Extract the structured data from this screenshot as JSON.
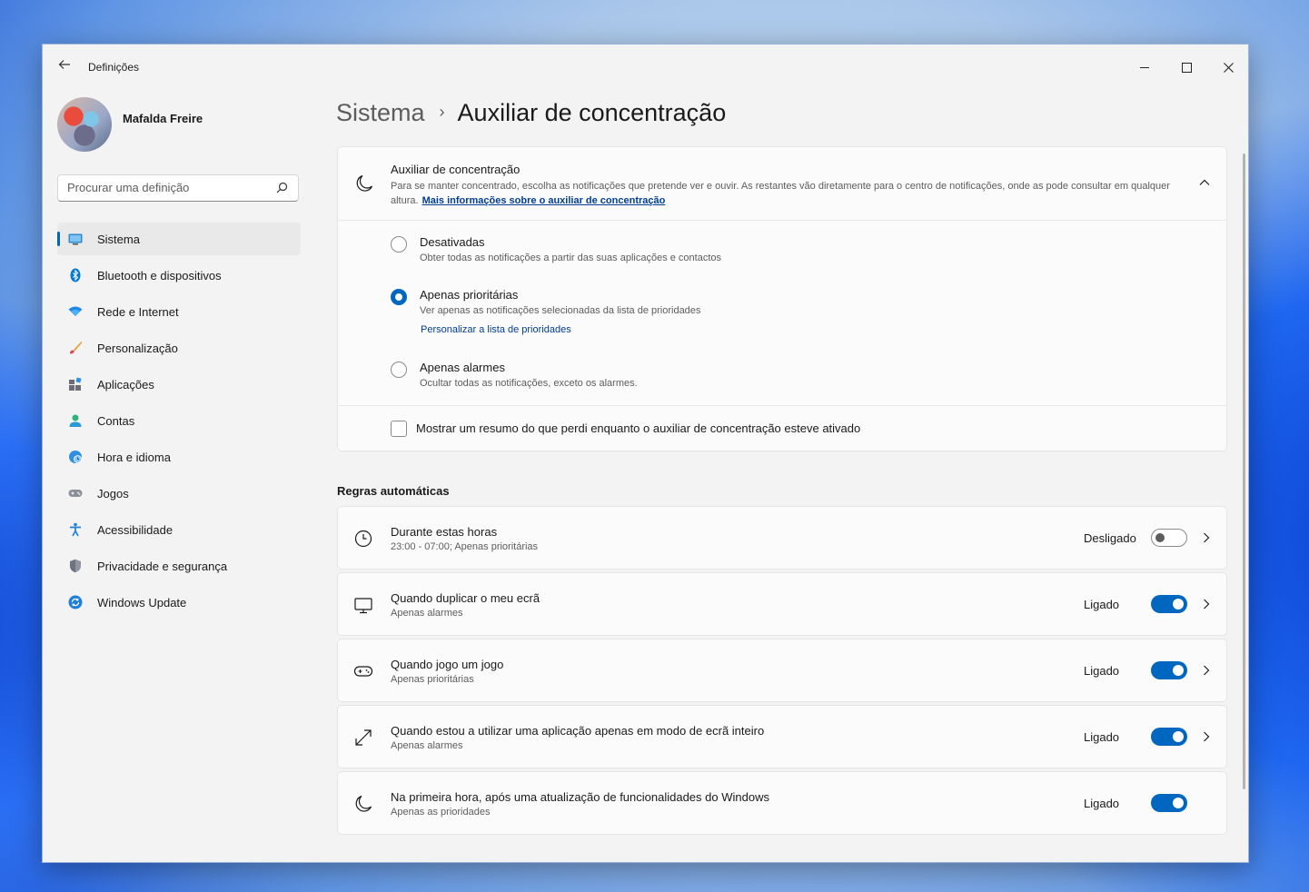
{
  "app": {
    "title": "Definições"
  },
  "user": {
    "name": "Mafalda Freire"
  },
  "search": {
    "placeholder": "Procurar uma definição"
  },
  "sidebar": {
    "items": [
      {
        "label": "Sistema",
        "icon": "system-icon",
        "active": true
      },
      {
        "label": "Bluetooth e dispositivos",
        "icon": "bluetooth-icon"
      },
      {
        "label": "Rede e Internet",
        "icon": "wifi-icon"
      },
      {
        "label": "Personalização",
        "icon": "brush-icon"
      },
      {
        "label": "Aplicações",
        "icon": "apps-icon"
      },
      {
        "label": "Contas",
        "icon": "account-icon"
      },
      {
        "label": "Hora e idioma",
        "icon": "globe-clock-icon"
      },
      {
        "label": "Jogos",
        "icon": "gamepad-icon"
      },
      {
        "label": "Acessibilidade",
        "icon": "accessibility-icon"
      },
      {
        "label": "Privacidade e segurança",
        "icon": "shield-icon"
      },
      {
        "label": "Windows Update",
        "icon": "update-icon"
      }
    ]
  },
  "breadcrumb": {
    "parent": "Sistema",
    "current": "Auxiliar de concentração"
  },
  "focus": {
    "title": "Auxiliar de concentração",
    "description": "Para se manter concentrado, escolha as notificações que pretende ver e ouvir. As restantes vão diretamente para o centro de notificações, onde as pode consultar em qualquer altura.",
    "link": "Mais informações sobre o auxiliar de concentração",
    "options": [
      {
        "title": "Desativadas",
        "subtitle": "Obter todas as notificações a partir das suas aplicações e contactos",
        "selected": false
      },
      {
        "title": "Apenas prioritárias",
        "subtitle": "Ver apenas as notificações selecionadas da lista de prioridades",
        "link": "Personalizar a lista de prioridades",
        "selected": true
      },
      {
        "title": "Apenas alarmes",
        "subtitle": "Ocultar todas as notificações, exceto os alarmes.",
        "selected": false
      }
    ],
    "summary_checkbox": {
      "label": "Mostrar um resumo do que perdi enquanto o auxiliar de concentração esteve ativado",
      "checked": false
    }
  },
  "rules": {
    "heading": "Regras automáticas",
    "items": [
      {
        "title": "Durante estas horas",
        "subtitle": "23:00 - 07:00; Apenas prioritárias",
        "state": "Desligado",
        "on": false,
        "icon": "clock-icon"
      },
      {
        "title": "Quando duplicar o meu ecrã",
        "subtitle": "Apenas alarmes",
        "state": "Ligado",
        "on": true,
        "icon": "monitor-icon"
      },
      {
        "title": "Quando jogo um jogo",
        "subtitle": "Apenas prioritárias",
        "state": "Ligado",
        "on": true,
        "icon": "gamepad-icon"
      },
      {
        "title": "Quando estou a utilizar uma aplicação apenas em modo de ecrã inteiro",
        "subtitle": "Apenas alarmes",
        "state": "Ligado",
        "on": true,
        "icon": "fullscreen-icon"
      },
      {
        "title": "Na primeira hora, após uma atualização de funcionalidades do Windows",
        "subtitle": "Apenas as prioridades",
        "state": "Ligado",
        "on": true,
        "icon": "moon-icon"
      }
    ]
  },
  "colors": {
    "accent": "#0067c0",
    "link": "#003e92"
  }
}
